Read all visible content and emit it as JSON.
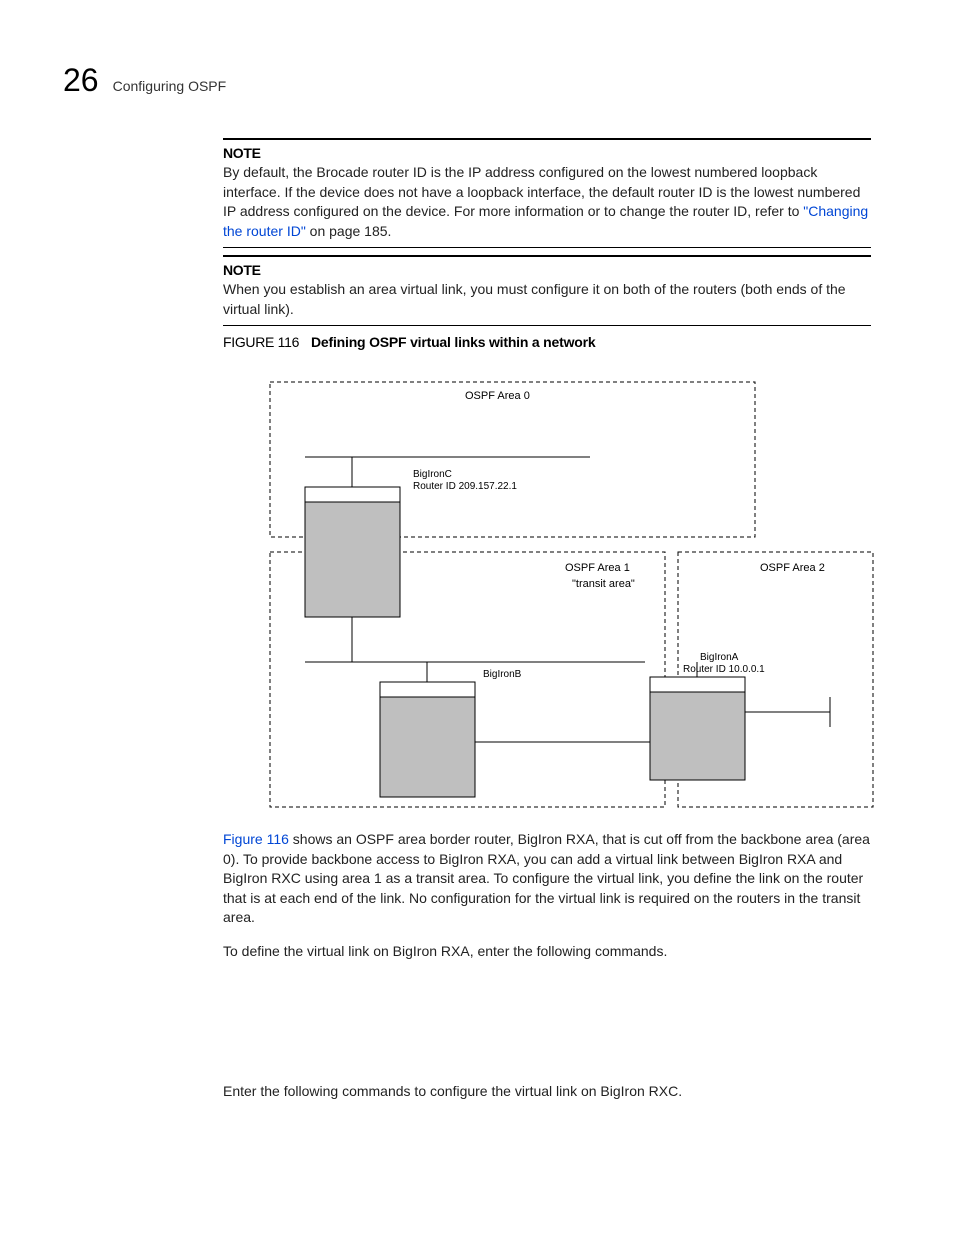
{
  "header": {
    "chapter_number": "26",
    "chapter_title": "Configuring OSPF"
  },
  "note1": {
    "heading": "NOTE",
    "body_pre": "By default, the Brocade router ID is the IP address configured on the lowest numbered loopback interface. If the device does not have a loopback interface, the default router ID is the lowest numbered IP address configured on the device. For more information or to change the router ID, refer to ",
    "link_text": "\"Changing the router ID\"",
    "body_post": " on page 185."
  },
  "note2": {
    "heading": "NOTE",
    "body": "When you establish an area virtual link, you must configure it on both of the routers (both ends of the virtual link)."
  },
  "figure": {
    "label": "FIGURE 116",
    "title": "Defining OSPF virtual links within a network"
  },
  "diagram": {
    "area0": "OSPF Area 0",
    "area1_a": "OSPF Area 1",
    "area1_b": "\"transit area\"",
    "area2": "OSPF Area 2",
    "routerC_name": "BigIronC",
    "routerC_id": "Router ID 209.157.22.1",
    "routerB_name": "BigIronB",
    "routerA_name": "BigIronA",
    "routerA_id": "Router ID 10.0.0.1"
  },
  "para1": {
    "link": "Figure 116",
    "rest": " shows an OSPF area border router, BigIron RXA, that is cut off from the backbone area (area 0). To provide backbone access to BigIron RXA, you can add a virtual link between BigIron RXA and BigIron RXC using area 1 as a transit area. To configure the virtual link, you define the link on the router that is at each end of the link. No configuration for the virtual link is required on the routers in the transit area."
  },
  "para2": "To define the virtual link on BigIron RXA, enter the following commands.",
  "para3": "Enter the following commands to configure the virtual link on BigIron RXC."
}
